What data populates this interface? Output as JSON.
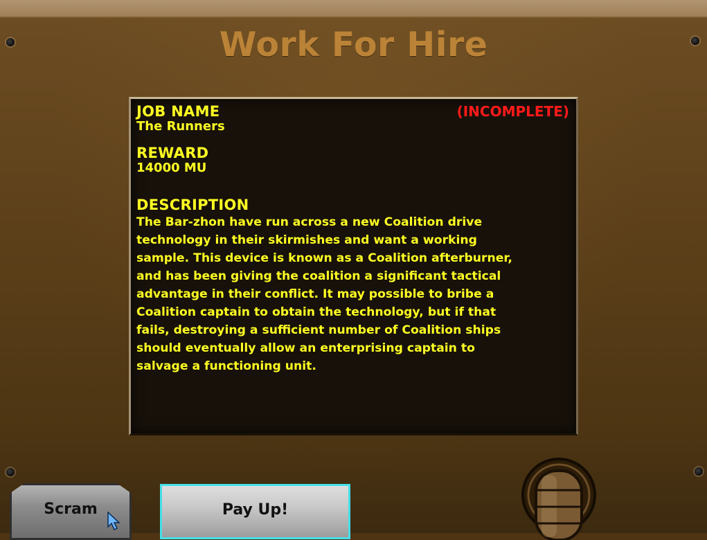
{
  "screen_title": "Work For Hire",
  "job": {
    "name_heading": "JOB NAME",
    "name": "The Runners",
    "status": "(INCOMPLETE)",
    "reward_heading": "REWARD",
    "reward": "14000 MU",
    "description_heading": "DESCRIPTION",
    "description": "The Bar-zhon have run across a new Coalition drive\ntechnology in their skirmishes and want a working\nsample.  This device is known as a Coalition afterburner,\nand has been giving the coalition a significant tactical\nadvantage in their conflict.  It may possible to bribe a\nCoalition captain to obtain the technology, but if that\nfails, destroying a sufficient number of Coalition ships\nshould eventually allow an enterprising captain to\nsalvage a functioning unit."
  },
  "buttons": {
    "scram": "Scram",
    "pay_up": "Pay Up!"
  },
  "colors": {
    "title": "#bb8337",
    "text": "#ffff22",
    "status": "#ff1a1a",
    "screen_bg": "#17110a",
    "selected_border": "#45e0e8"
  },
  "icons": {
    "cursor": "arrow-cursor-icon",
    "lever": "lever-knob-icon",
    "bolt": "bolt-icon"
  }
}
